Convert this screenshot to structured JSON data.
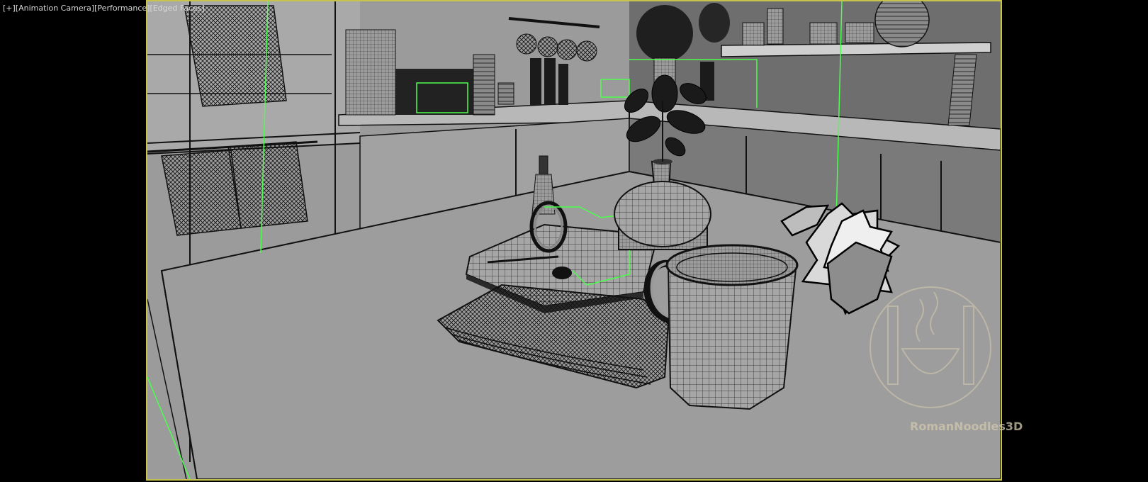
{
  "viewport": {
    "label_plus": "[+]",
    "label_camera": "[Animation Camera]",
    "label_shading": "[Performance]",
    "label_edges": "[Edged Faces]"
  },
  "watermark": {
    "text": "RomanNoodles3D",
    "logo_icon": "noodle-bowl-columns-icon"
  },
  "colors": {
    "frame_border": "#c8c34a",
    "selection_green": "#4cff4c",
    "background": "#000000",
    "scene_gray": "#9a9a9a"
  }
}
